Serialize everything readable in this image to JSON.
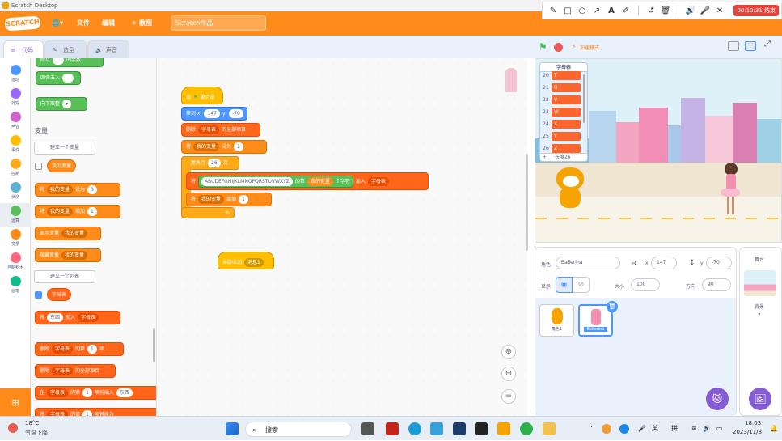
{
  "window": {
    "title": "Scratch Desktop"
  },
  "annotation_toolbar": {
    "timer": "00:10:31 结束"
  },
  "menubar": {
    "logo": "SCRATCH",
    "file": "文件",
    "edit": "编辑",
    "tutorials": "教程",
    "project_name": "Scratch作品"
  },
  "tabs": {
    "code": "代码",
    "costumes": "造型",
    "sounds": "声音"
  },
  "categories": [
    {
      "label": "运动",
      "color": "#4c97ff"
    },
    {
      "label": "外观",
      "color": "#9966ff"
    },
    {
      "label": "声音",
      "color": "#cf63cf"
    },
    {
      "label": "事件",
      "color": "#ffbf00"
    },
    {
      "label": "控制",
      "color": "#ffab19"
    },
    {
      "label": "侦测",
      "color": "#5cb1d6"
    },
    {
      "label": "运算",
      "color": "#59c059"
    },
    {
      "label": "变量",
      "color": "#ff8c1a"
    },
    {
      "label": "自制积木",
      "color": "#ff6680"
    },
    {
      "label": "画笔",
      "color": "#0fbd8c"
    }
  ],
  "palette": {
    "op_partial": "除以",
    "op_round": "四舍五入",
    "op_partial2": "的余数",
    "op_floor": "向下取整",
    "variables_heading": "变量",
    "make_variable": "建立一个变量",
    "my_variable": "我的变量",
    "set_label": "将",
    "set_to": "设为",
    "set_value": "0",
    "change_by": "增加",
    "change_value": "1",
    "show_var": "显示变量",
    "hide_var": "隐藏变量",
    "make_list": "建立一个列表",
    "list_name": "字母表",
    "add_label": "将",
    "add_item": "东西",
    "add_to": "加入",
    "delete_label": "删除",
    "delete_nth": "的第",
    "delete_item": "项",
    "delete_value": "1",
    "delete_all": "的全部项目",
    "insert_label": "在",
    "insert_pos": "的第",
    "insert_value": "1",
    "insert_item": "项前插入",
    "insert_thing": "东西",
    "replace_label": "将",
    "replace_item": "项替换为"
  },
  "script": {
    "when_flag": "当",
    "clicked": "被点击",
    "goto": "移到 x:",
    "x": "147",
    "y_label": "y:",
    "y": "-70",
    "delete_label": "删除",
    "list": "字母表",
    "delete_all": "的全部项目",
    "set_label": "将",
    "var": "我的变量",
    "set_to": "设为",
    "set_value": "1",
    "repeat": "重复执行",
    "repeat_count": "26",
    "repeat_unit": "次",
    "add_label": "将",
    "letters": "ABCDEFGHIJKLMNOPQRSTUVWXYZ",
    "of": "的第",
    "char": "个字符",
    "add_to": "加入",
    "change_label": "将",
    "change_by": "增加",
    "change_value": "1",
    "receive": "当接收到",
    "message": "消息1"
  },
  "stage": {
    "turbo": "加速模式",
    "list_monitor": {
      "title": "字母表",
      "rows": [
        {
          "i": "20",
          "v": "T"
        },
        {
          "i": "21",
          "v": "U"
        },
        {
          "i": "22",
          "v": "V"
        },
        {
          "i": "23",
          "v": "W"
        },
        {
          "i": "24",
          "v": "X"
        },
        {
          "i": "25",
          "v": "Y"
        },
        {
          "i": "26",
          "v": "Z"
        }
      ],
      "add": "+",
      "length": "长度26"
    }
  },
  "sprite_info": {
    "sprite_label": "角色",
    "sprite_name": "Ballerina",
    "x_label": "x",
    "x": "147",
    "y_label": "y",
    "y": "-70",
    "show_label": "显示",
    "size_label": "大小",
    "size": "100",
    "direction_label": "方向",
    "direction": "90",
    "sprites": [
      {
        "name": "角色1"
      },
      {
        "name": "Ballerina"
      }
    ]
  },
  "backdrop_panel": {
    "title": "舞台",
    "backdrop_label": "背景",
    "count": "2"
  },
  "taskbar": {
    "weather_temp": "18°C",
    "weather_desc": "气温下降",
    "search": "搜索",
    "ime1": "英",
    "ime2": "拼",
    "time": "18:03",
    "date": "2023/11/8"
  }
}
